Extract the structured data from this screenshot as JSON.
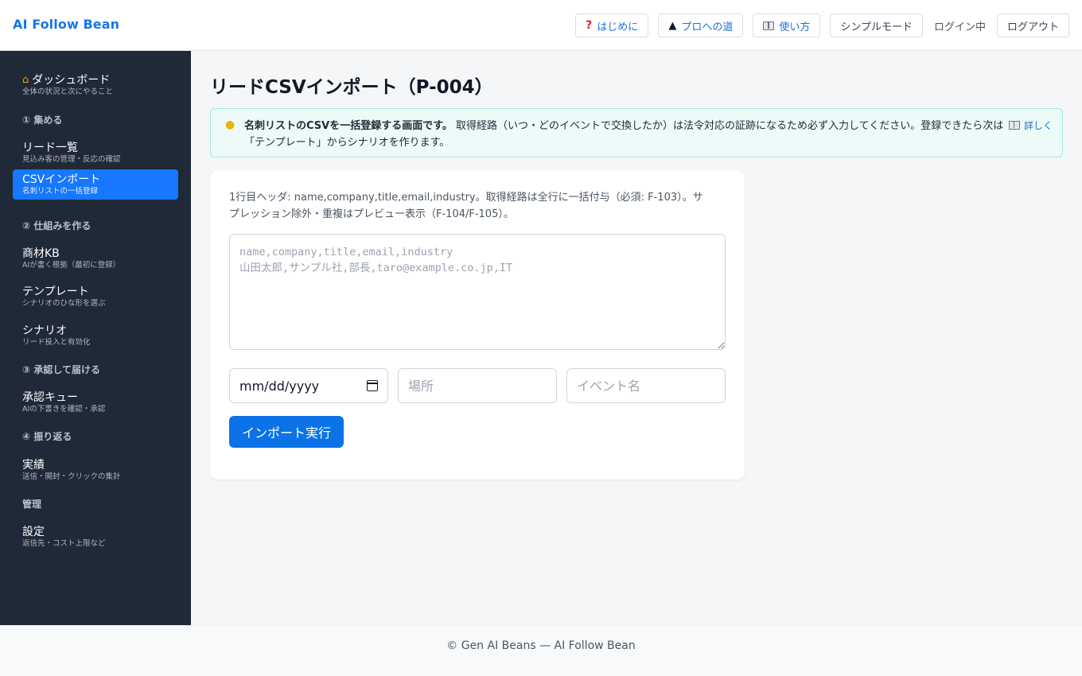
{
  "header": {
    "brand": "AI Follow Bean",
    "nav": {
      "start": "はじめに",
      "pro": "プロへの道",
      "howto": "使い方",
      "simple": "シンプルモード",
      "status": "ログイン中",
      "logout": "ログアウト"
    }
  },
  "sidebar": {
    "dashboard": {
      "label": "ダッシュボード",
      "sub": "全体の状況と次にやること"
    },
    "sections": [
      "① 集める",
      "② 仕組みを作る",
      "③ 承認して届ける",
      "④ 振り返る",
      "管理"
    ],
    "items": [
      {
        "label": "リード一覧",
        "sub": "見込み客の管理・反応の確認"
      },
      {
        "label": "CSVインポート",
        "sub": "名刺リストの一括登録"
      },
      {
        "label": "商材KB",
        "sub": "AIが書く根拠（最初に登録）"
      },
      {
        "label": "テンプレート",
        "sub": "シナリオのひな形を選ぶ"
      },
      {
        "label": "シナリオ",
        "sub": "リード投入と有効化"
      },
      {
        "label": "承認キュー",
        "sub": "AIの下書きを確認・承認"
      },
      {
        "label": "実績",
        "sub": "送信・開封・クリックの集計"
      },
      {
        "label": "設定",
        "sub": "返信先・コスト上限など"
      }
    ],
    "active_index": 1
  },
  "main": {
    "title": "リードCSVインポート（P-004）",
    "info": {
      "bold": "名刺リストのCSVを一括登録する画面です。",
      "text": " 取得経路（いつ・どのイベントで交換したか）は法令対応の証跡になるため必ず入力してください。登録できたら次は「テンプレート」からシナリオを作ります。",
      "more": "詳しく"
    },
    "form": {
      "help": "1行目ヘッダ: name,company,title,email,industry。取得経路は全行に一括付与（必須: F-103）。サプレッション除外・重複はプレビュー表示（F-104/F-105）。",
      "csv_placeholder": "name,company,title,email,industry\n山田太郎,サンプル社,部長,taro@example.co.jp,IT",
      "date_value": "mm/dd/yyyy",
      "place_placeholder": "場所",
      "event_placeholder": "イベント名",
      "submit": "インポート実行"
    }
  },
  "footer": {
    "text": "© Gen AI Beans — AI Follow Bean"
  },
  "colors": {
    "brand": "#1677e6",
    "sidebar_bg": "#1f2937",
    "active": "#1677ff",
    "primary_button": "#0b72e7",
    "info_bg": "#ecfbf7"
  },
  "icons": {
    "start": "question-icon",
    "pro": "graduation-cap-icon",
    "howto": "book-icon",
    "info": "lightbulb-icon",
    "dashboard": "house-icon",
    "date": "calendar-icon"
  }
}
